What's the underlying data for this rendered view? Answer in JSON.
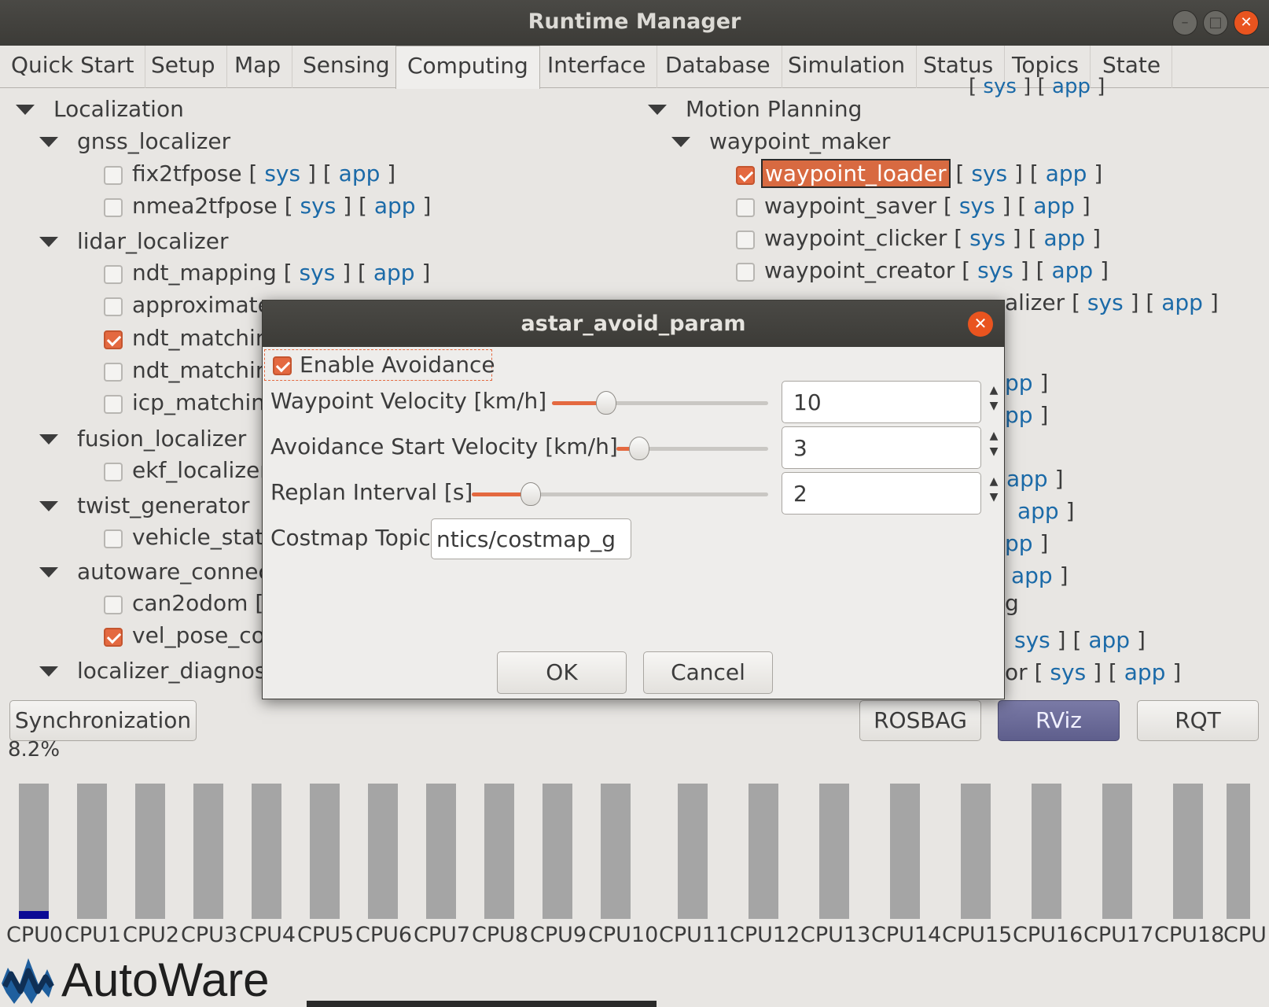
{
  "window": {
    "title": "Runtime Manager"
  },
  "tabs": [
    "Quick Start",
    "Setup",
    "Map",
    "Sensing",
    "Computing",
    "Interface",
    "Database",
    "Simulation",
    "Status",
    "Topics",
    "State"
  ],
  "active_tab": "Computing",
  "common": {
    "sys": "sys",
    "app": "app",
    "lb": "[",
    "rb": "]"
  },
  "left_tree": {
    "localization": "Localization",
    "gnss_localizer": "gnss_localizer",
    "fix2tfpose": "fix2tfpose",
    "nmea2tfpose": "nmea2tfpose",
    "lidar_localizer": "lidar_localizer",
    "ndt_mapping": "ndt_mapping",
    "approximate": "approximate",
    "ndt_matching_a": "ndt_matchin",
    "ndt_matching_b": "ndt_matchin",
    "icp_matching": "icp_matching",
    "fusion_localizer": "fusion_localizer",
    "ekf_localizer": "ekf_localizer",
    "twist_generator": "twist_generator",
    "vehicle_status": "vehicle_statu",
    "autoware_connector": "autoware_connec",
    "can2odom": "can2odom",
    "vel_pose": "vel_pose_co",
    "localizer_diag": "localizer_diagnos"
  },
  "right_tree": {
    "motion_planning": "Motion Planning",
    "waypoint_maker": "waypoint_maker",
    "waypoint_loader": "waypoint_loader",
    "waypoint_saver": "waypoint_saver",
    "waypoint_clicker": "waypoint_clicker",
    "waypoint_creator": "waypoint_creator",
    "alizer": "alizer",
    "pp": "pp",
    "g": "g",
    "or": "or"
  },
  "bottom_buttons": {
    "sync": "Synchronization",
    "rosbag": "ROSBAG",
    "rviz": "RViz",
    "rqt": "RQT"
  },
  "cpu": {
    "total_label": "8.2%",
    "labels": [
      "CPU0",
      "CPU1",
      "CPU2",
      "CPU3",
      "CPU4",
      "CPU5",
      "CPU6",
      "CPU7",
      "CPU8",
      "CPU9",
      "CPU10",
      "CPU11",
      "CPU12",
      "CPU13",
      "CPU14",
      "CPU15",
      "CPU16",
      "CPU17",
      "CPU18",
      "CPU"
    ],
    "usage_percent": [
      6,
      0,
      0,
      0,
      0,
      0,
      0,
      0,
      0,
      0,
      0,
      0,
      0,
      0,
      0,
      0,
      0,
      0,
      0,
      0
    ],
    "fill_color": "#0b0b95"
  },
  "logo": {
    "text": "AutoWare"
  },
  "dialog": {
    "title": "astar_avoid_param",
    "enable_avoidance": "Enable Avoidance",
    "enable_checked": true,
    "waypoint_velocity": {
      "label": "Waypoint Velocity [km/h]",
      "value": "10",
      "slider_fraction": 0.25
    },
    "avoid_start_velocity": {
      "label": "Avoidance Start Velocity [km/h]",
      "value": "3",
      "slider_fraction": 0.15
    },
    "replan_interval": {
      "label": "Replan Interval [s]",
      "value": "2",
      "slider_fraction": 0.2
    },
    "costmap_topic": {
      "label": "Costmap Topic",
      "value": "ntics/costmap_g"
    },
    "ok": "OK",
    "cancel": "Cancel"
  },
  "colors": {
    "accent": "#e46940",
    "link": "#1b6aa8",
    "titlebar": "#3c3b37",
    "rviz": "#6a6a98"
  }
}
